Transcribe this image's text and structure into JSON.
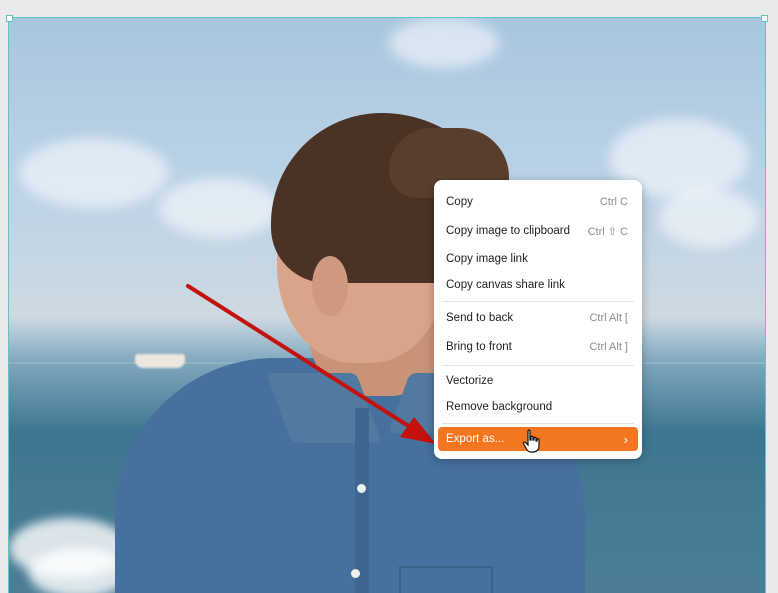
{
  "context_menu": {
    "items": [
      {
        "label": "Copy",
        "shortcut": "Ctrl C"
      },
      {
        "label": "Copy image to clipboard",
        "shortcut": "Ctrl ⇧ C"
      },
      {
        "label": "Copy image link",
        "shortcut": ""
      },
      {
        "label": "Copy canvas share link",
        "shortcut": ""
      },
      {
        "label": "Send to back",
        "shortcut": "Ctrl Alt ["
      },
      {
        "label": "Bring to front",
        "shortcut": "Ctrl Alt ]"
      },
      {
        "label": "Vectorize",
        "shortcut": ""
      },
      {
        "label": "Remove background",
        "shortcut": ""
      },
      {
        "label": "Export as...",
        "shortcut": "",
        "submenu_icon": "chevron-right-icon",
        "highlighted": true
      }
    ]
  },
  "colors": {
    "highlight": "#f37621",
    "selection_outline": "#5fc4c4",
    "annotation_arrow": "#c4120f"
  },
  "icons": {
    "cursor": "hand-pointer-icon",
    "submenu": "chevron-right-icon"
  }
}
